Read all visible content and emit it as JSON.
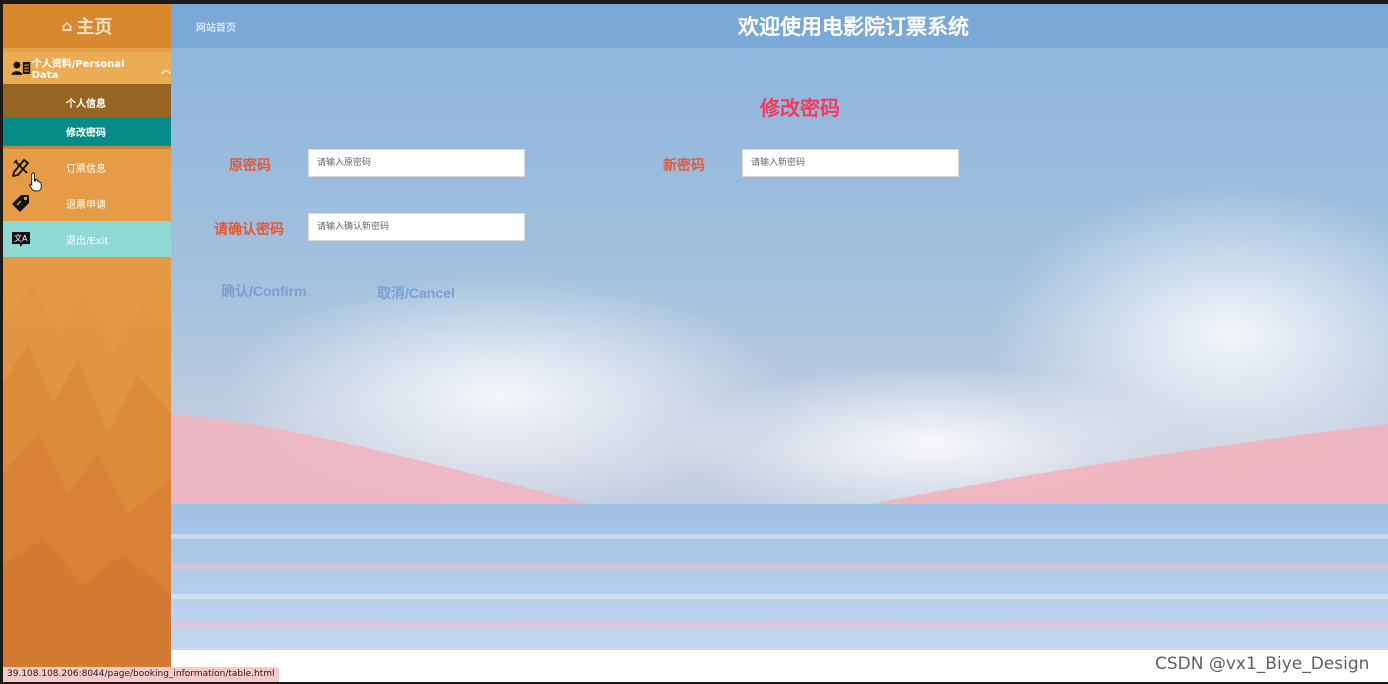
{
  "sidebar": {
    "brand": "主页",
    "menu_head": "个人资料/Personal Data",
    "sub_items": [
      "个人信息",
      "修改密码"
    ],
    "nav": [
      "订票信息",
      "退票申请",
      "退出/Exit"
    ]
  },
  "header": {
    "breadcrumb": "网站首页",
    "title": "欢迎使用电影院订票系统"
  },
  "form": {
    "title": "修改密码",
    "old_password": {
      "label": "原密码",
      "placeholder": "请输入原密码",
      "value": ""
    },
    "new_password": {
      "label": "新密码",
      "placeholder": "请输入新密码",
      "value": ""
    },
    "confirm_password": {
      "label": "请确认密码",
      "placeholder": "请输入确认新密码",
      "value": ""
    },
    "confirm_button": "确认/Confirm",
    "cancel_button": "取消/Cancel"
  },
  "status_url": "39.108.108.206:8044/page/booking_information/table.html",
  "watermark": "CSDN @vx1_Biye_Design",
  "colors": {
    "sidebar_bg": "#e59a44",
    "active_item": "#058c88",
    "topbar": "#7aa9d8",
    "form_title": "#f23b5c",
    "labels": "#e05a3a",
    "buttons": "#7c9fd1"
  },
  "icons": [
    "home-icon",
    "person-card-icon",
    "chevron-up-icon",
    "pencil-ruler-icon",
    "tag-icon",
    "translate-icon",
    "hand-pointer-icon"
  ]
}
